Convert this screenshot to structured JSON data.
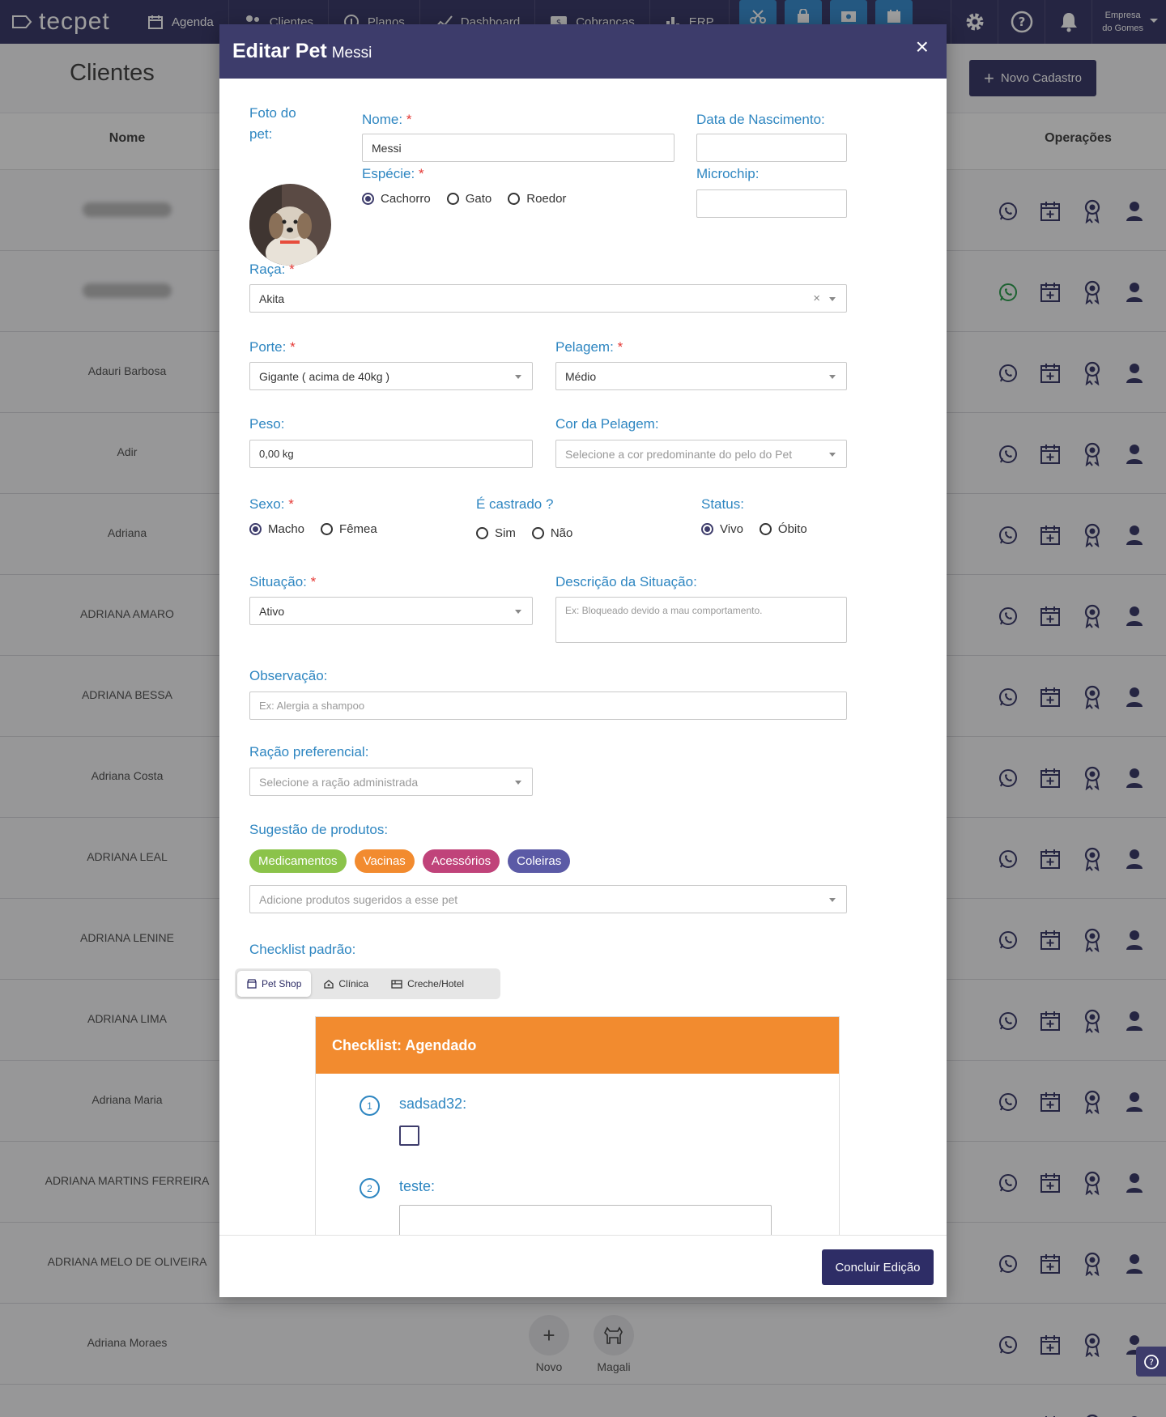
{
  "app": {
    "logo": "tecpet"
  },
  "nav": [
    {
      "label": "Agenda",
      "icon": "calendar-icon"
    },
    {
      "label": "Clientes",
      "icon": "users-icon"
    },
    {
      "label": "Planos",
      "icon": "plans-icon"
    },
    {
      "label": "Dashboard",
      "icon": "chart-line-icon"
    },
    {
      "label": "Cobranças",
      "icon": "billing-icon"
    },
    {
      "label": "ERP",
      "icon": "bar-chart-icon"
    }
  ],
  "company": {
    "line1": "Empresa",
    "line2": "do Gomes"
  },
  "page": {
    "title": "Clientes",
    "new_button": "Novo Cadastro"
  },
  "table": {
    "headers": {
      "name": "Nome",
      "operations": "Operações"
    },
    "rows": [
      {
        "name": ""
      },
      {
        "name": ""
      },
      {
        "name": "Adauri Barbosa"
      },
      {
        "name": "Adir"
      },
      {
        "name": "Adriana"
      },
      {
        "name": "ADRIANA AMARO"
      },
      {
        "name": "ADRIANA BESSA"
      },
      {
        "name": "Adriana Costa"
      },
      {
        "name": "ADRIANA LEAL"
      },
      {
        "name": "ADRIANA LENINE"
      },
      {
        "name": "ADRIANA LIMA"
      },
      {
        "name": "Adriana Maria"
      },
      {
        "name": "ADRIANA MARTINS FERREIRA"
      },
      {
        "name": "ADRIANA MELO DE OLIVEIRA"
      },
      {
        "name": "Adriana Moraes"
      },
      {
        "name": ""
      }
    ],
    "pets": {
      "new_label": "Novo",
      "pet_name": "Magali"
    }
  },
  "modal": {
    "title": "Editar Pet",
    "subtitle": "Messi",
    "close": "×",
    "photo_label": "Foto do pet:",
    "name": {
      "label": "Nome:",
      "value": "Messi"
    },
    "birth": {
      "label": "Data de Nascimento:",
      "value": ""
    },
    "species": {
      "label": "Espécie:",
      "options": [
        "Cachorro",
        "Gato",
        "Roedor"
      ],
      "selected": "Cachorro"
    },
    "microchip": {
      "label": "Microchip:",
      "value": ""
    },
    "breed": {
      "label": "Raça:",
      "value": "Akita"
    },
    "size": {
      "label": "Porte:",
      "value": "Gigante ( acima de 40kg )"
    },
    "coat": {
      "label": "Pelagem:",
      "value": "Médio"
    },
    "weight": {
      "label": "Peso:",
      "value": "0,00 kg"
    },
    "coat_color": {
      "label": "Cor da Pelagem:",
      "placeholder": "Selecione a cor predominante do pelo do Pet"
    },
    "sex": {
      "label": "Sexo:",
      "options": [
        "Macho",
        "Fêmea"
      ],
      "selected": "Macho"
    },
    "neutered": {
      "label": "É castrado ?",
      "options": [
        "Sim",
        "Não"
      ],
      "selected": ""
    },
    "status": {
      "label": "Status:",
      "options": [
        "Vivo",
        "Óbito"
      ],
      "selected": "Vivo"
    },
    "situation": {
      "label": "Situação:",
      "value": "Ativo"
    },
    "situation_desc": {
      "label": "Descrição da Situação:",
      "placeholder": "Ex: Bloqueado devido a mau comportamento."
    },
    "observation": {
      "label": "Observação:",
      "placeholder": "Ex: Alergia a shampoo"
    },
    "food": {
      "label": "Ração preferencial:",
      "placeholder": "Selecione a ração administrada"
    },
    "suggestions": {
      "label": "Sugestão de produtos:",
      "chips": [
        {
          "label": "Medicamentos",
          "color": "#8bc34a"
        },
        {
          "label": "Vacinas",
          "color": "#f28b2f"
        },
        {
          "label": "Acessórios",
          "color": "#c0437a"
        },
        {
          "label": "Coleiras",
          "color": "#5b5aa6"
        }
      ],
      "placeholder": "Adicione produtos sugeridos a esse pet"
    },
    "checklist": {
      "label": "Checklist padrão:",
      "tabs": [
        "Pet Shop",
        "Clínica",
        "Creche/Hotel"
      ],
      "active_tab": "Pet Shop",
      "card_title": "Checklist: Agendado",
      "items": [
        {
          "number": "1",
          "label": "sadsad32:"
        },
        {
          "number": "2",
          "label": "teste:"
        }
      ]
    },
    "save_button": "Concluir Edição"
  },
  "colors": {
    "primary": "#3d3c6b",
    "accent_blue": "#2e86c1",
    "required": "#e53935",
    "checklist_header": "#f28b2f"
  }
}
